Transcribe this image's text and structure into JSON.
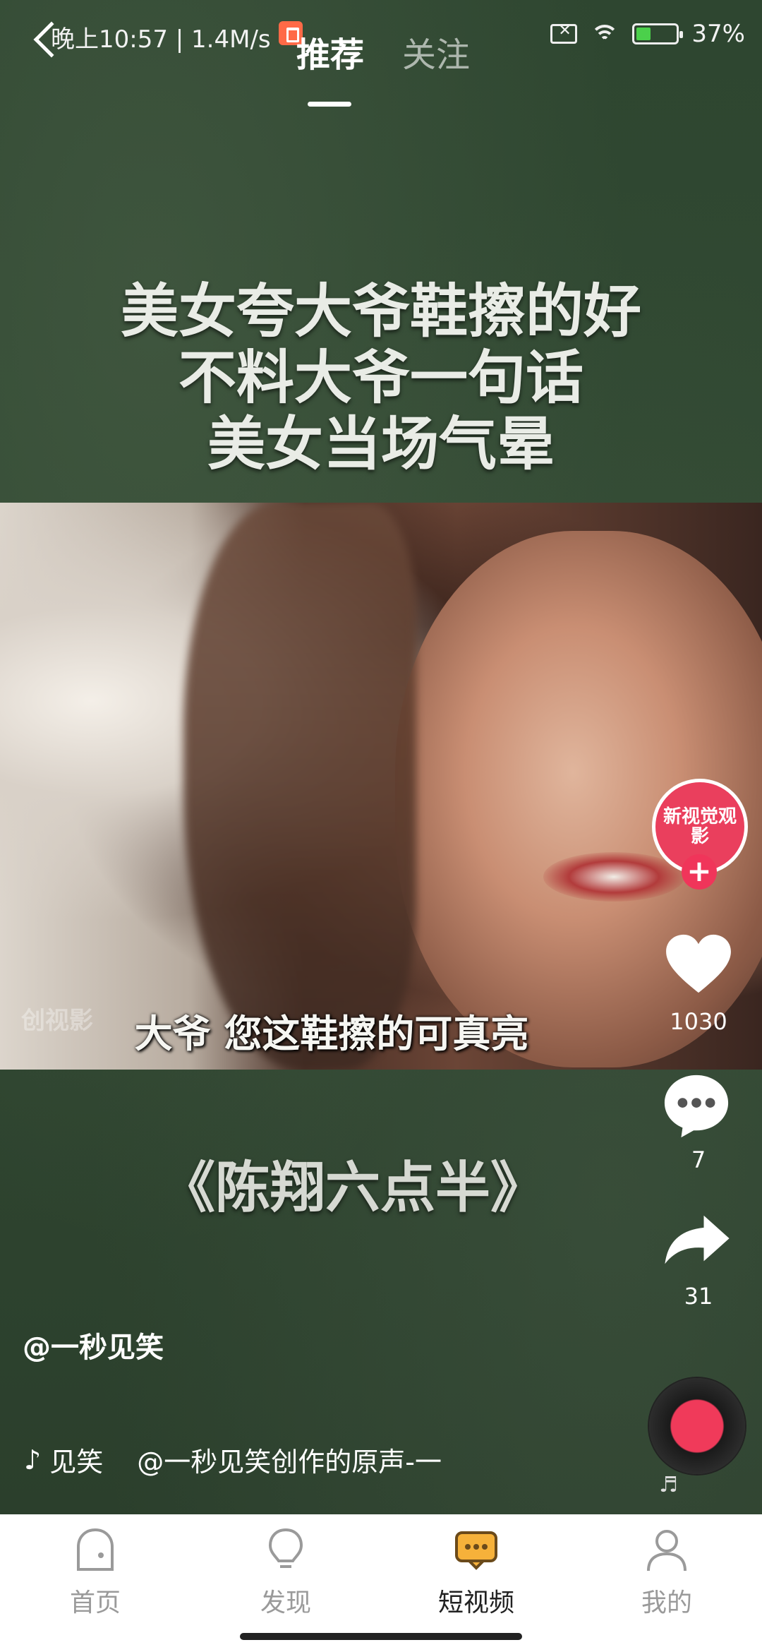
{
  "status_bar": {
    "time": "晚上10:57 | 1.4M/s",
    "battery": "37%",
    "battery_level": 0.37
  },
  "top_tabs": {
    "active": "推荐",
    "inactive": "关注"
  },
  "video": {
    "headline_lines": [
      "美女夸大爷鞋擦的好",
      "不料大爷一句话",
      "美女当场气晕"
    ],
    "watermark": "创视影",
    "subtitle": "大爷 您这鞋擦的可真亮",
    "overlay_title": "《陈翔六点半》"
  },
  "rail": {
    "avatar_text": "新视觉观影",
    "follow_symbol": "+",
    "likes": "1030",
    "comments": "7",
    "shares": "31",
    "disc_note": "♬"
  },
  "author": "@一秒见笑",
  "music": {
    "tag": "见笑",
    "note_icon": "♪",
    "text": "@一秒见笑创作的原声-一"
  },
  "bottom_nav": [
    {
      "label": "首页",
      "icon": "home-icon"
    },
    {
      "label": "发现",
      "icon": "lightbulb-icon"
    },
    {
      "label": "短视频",
      "icon": "short-video-icon",
      "active": true
    },
    {
      "label": "我的",
      "icon": "profile-icon"
    }
  ],
  "colors": {
    "accent": "#f0355a",
    "active_nav": "#222222",
    "inactive_nav": "#9a9a9a",
    "short_video_icon": "#f6b13a"
  }
}
